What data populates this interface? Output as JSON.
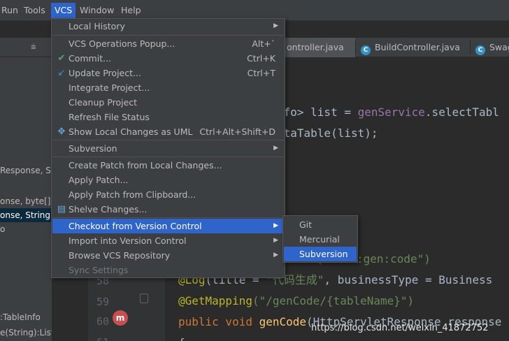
{
  "menubar": {
    "items": [
      {
        "label": "Run",
        "active": false
      },
      {
        "label": "Tools",
        "active": false
      },
      {
        "label": "VCS",
        "active": true
      },
      {
        "label": "Window",
        "active": false
      },
      {
        "label": "Help",
        "active": false
      }
    ]
  },
  "project_panel": {
    "lines": [
      "Response, St",
      "onse, byte[]):v",
      "onse, String):v",
      "o",
      ":TableInfo",
      "e(String):List<Column"
    ]
  },
  "tabs": [
    {
      "label": "ontroller.java",
      "active": true
    },
    {
      "label": "BuildController.java",
      "active": false,
      "icon": "C"
    },
    {
      "label": "Swag",
      "active": false,
      "icon": "C"
    }
  ],
  "editor": {
    "line1": ";",
    "line2_a": "nfo> list = ",
    "line2_b": "genService",
    "line2_c": ".selectTabl",
    "line3": "ataTable(list);",
    "line5_str": "sions(\"tool:gen:code\")",
    "line6_ann": "@Log",
    "line6_a": "(title = ",
    "line6_str": "\"代码生成\"",
    "line6_b": ", businessType = Business",
    "line7_ann": "@GetMapping",
    "line7_str": "(\"/genCode/{tableName}\")",
    "line8_kw": "public void ",
    "line8_fn": "genCode",
    "line8_a": "(HttpServletResponse response",
    "line9": "{",
    "line_numbers": [
      "58",
      "59",
      "60",
      "61"
    ]
  },
  "vcs_menu": {
    "local_history": "Local History",
    "operations_popup": "VCS Operations Popup...",
    "operations_popup_sc": "Alt+`",
    "commit": "Commit...",
    "commit_sc": "Ctrl+K",
    "update_project": "Update Project...",
    "update_project_sc": "Ctrl+T",
    "integrate_project": "Integrate Project...",
    "cleanup_project": "Cleanup Project",
    "refresh_status": "Refresh File Status",
    "show_changes_uml": "Show Local Changes as UML",
    "show_changes_uml_sc": "Ctrl+Alt+Shift+D",
    "subversion": "Subversion",
    "create_patch": "Create Patch from Local Changes...",
    "apply_patch": "Apply Patch...",
    "apply_patch_clipboard": "Apply Patch from Clipboard...",
    "shelve_changes": "Shelve Changes...",
    "checkout": "Checkout from Version Control",
    "import": "Import into Version Control",
    "browse_repo": "Browse VCS Repository",
    "sync_settings": "Sync Settings"
  },
  "checkout_menu": {
    "git": "Git",
    "mercurial": "Mercurial",
    "subversion": "Subversion"
  },
  "watermark": "https://blog.csdn.net/weixin_41872752",
  "colors": {
    "highlight": "#2f65ca",
    "menu_bg": "#3c3f41",
    "editor_bg": "#2b2b2b"
  }
}
